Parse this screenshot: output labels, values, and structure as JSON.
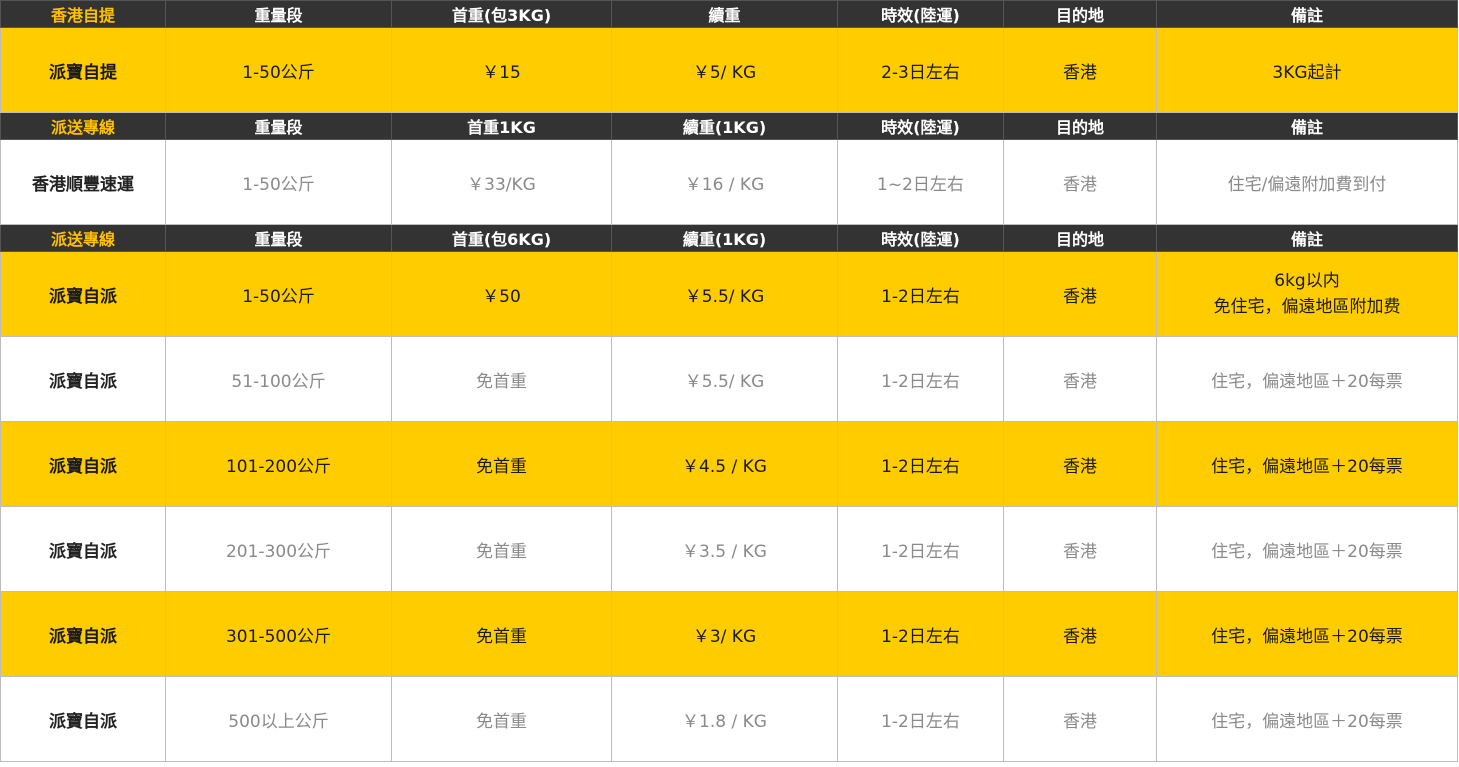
{
  "sections": [
    {
      "header": [
        "香港自提",
        "重量段",
        "首重(包3KG)",
        "續重",
        "時效(陸運)",
        "目的地",
        "備註"
      ],
      "rows": [
        {
          "style": "yellow",
          "cells": [
            "派寶自提",
            "1-50公斤",
            "￥15",
            "￥5/ KG",
            "2-3日左右",
            "香港",
            "3KG起計"
          ]
        }
      ]
    },
    {
      "header": [
        "派送專線",
        "重量段",
        "首重1KG",
        "續重(1KG)",
        "時效(陸運)",
        "目的地",
        "備註"
      ],
      "rows": [
        {
          "style": "white",
          "cells": [
            "香港順豐速運",
            "1-50公斤",
            "￥33/KG",
            "￥16 / KG",
            "1~2日左右",
            "香港",
            "住宅/偏遠附加費到付"
          ]
        }
      ]
    },
    {
      "header": [
        "派送專線",
        "重量段",
        "首重(包6KG)",
        "續重(1KG)",
        "時效(陸運)",
        "目的地",
        "備註"
      ],
      "rows": [
        {
          "style": "yellow",
          "cells": [
            "派寶自派",
            "1-50公斤",
            "￥50",
            "￥5.5/ KG",
            "1-2日左右",
            "香港",
            "6kg以内"
          ],
          "note_line2": "免住宅，偏遠地區附加费"
        },
        {
          "style": "white",
          "cells": [
            "派寶自派",
            "51-100公斤",
            "免首重",
            "￥5.5/ KG",
            "1-2日左右",
            "香港",
            "住宅，偏遠地區＋20每票"
          ]
        },
        {
          "style": "yellow",
          "cells": [
            "派寶自派",
            "101-200公斤",
            "免首重",
            "￥4.5 / KG",
            "1-2日左右",
            "香港",
            "住宅，偏遠地區＋20每票"
          ]
        },
        {
          "style": "white",
          "cells": [
            "派寶自派",
            "201-300公斤",
            "免首重",
            "￥3.5 / KG",
            "1-2日左右",
            "香港",
            "住宅，偏遠地區＋20每票"
          ]
        },
        {
          "style": "yellow",
          "cells": [
            "派寶自派",
            "301-500公斤",
            "免首重",
            "￥3/ KG",
            "1-2日左右",
            "香港",
            "住宅，偏遠地區＋20每票"
          ]
        },
        {
          "style": "white",
          "cells": [
            "派寶自派",
            "500以上公斤",
            "免首重",
            "￥1.8 / KG",
            "1-2日左右",
            "香港",
            "住宅，偏遠地區＋20每票"
          ]
        }
      ]
    }
  ],
  "colors": {
    "header_bg": "#333333",
    "header_accent": "#ffc000",
    "row_yellow": "#ffcc00",
    "row_white": "#ffffff",
    "muted_text": "#8a8a8a"
  }
}
